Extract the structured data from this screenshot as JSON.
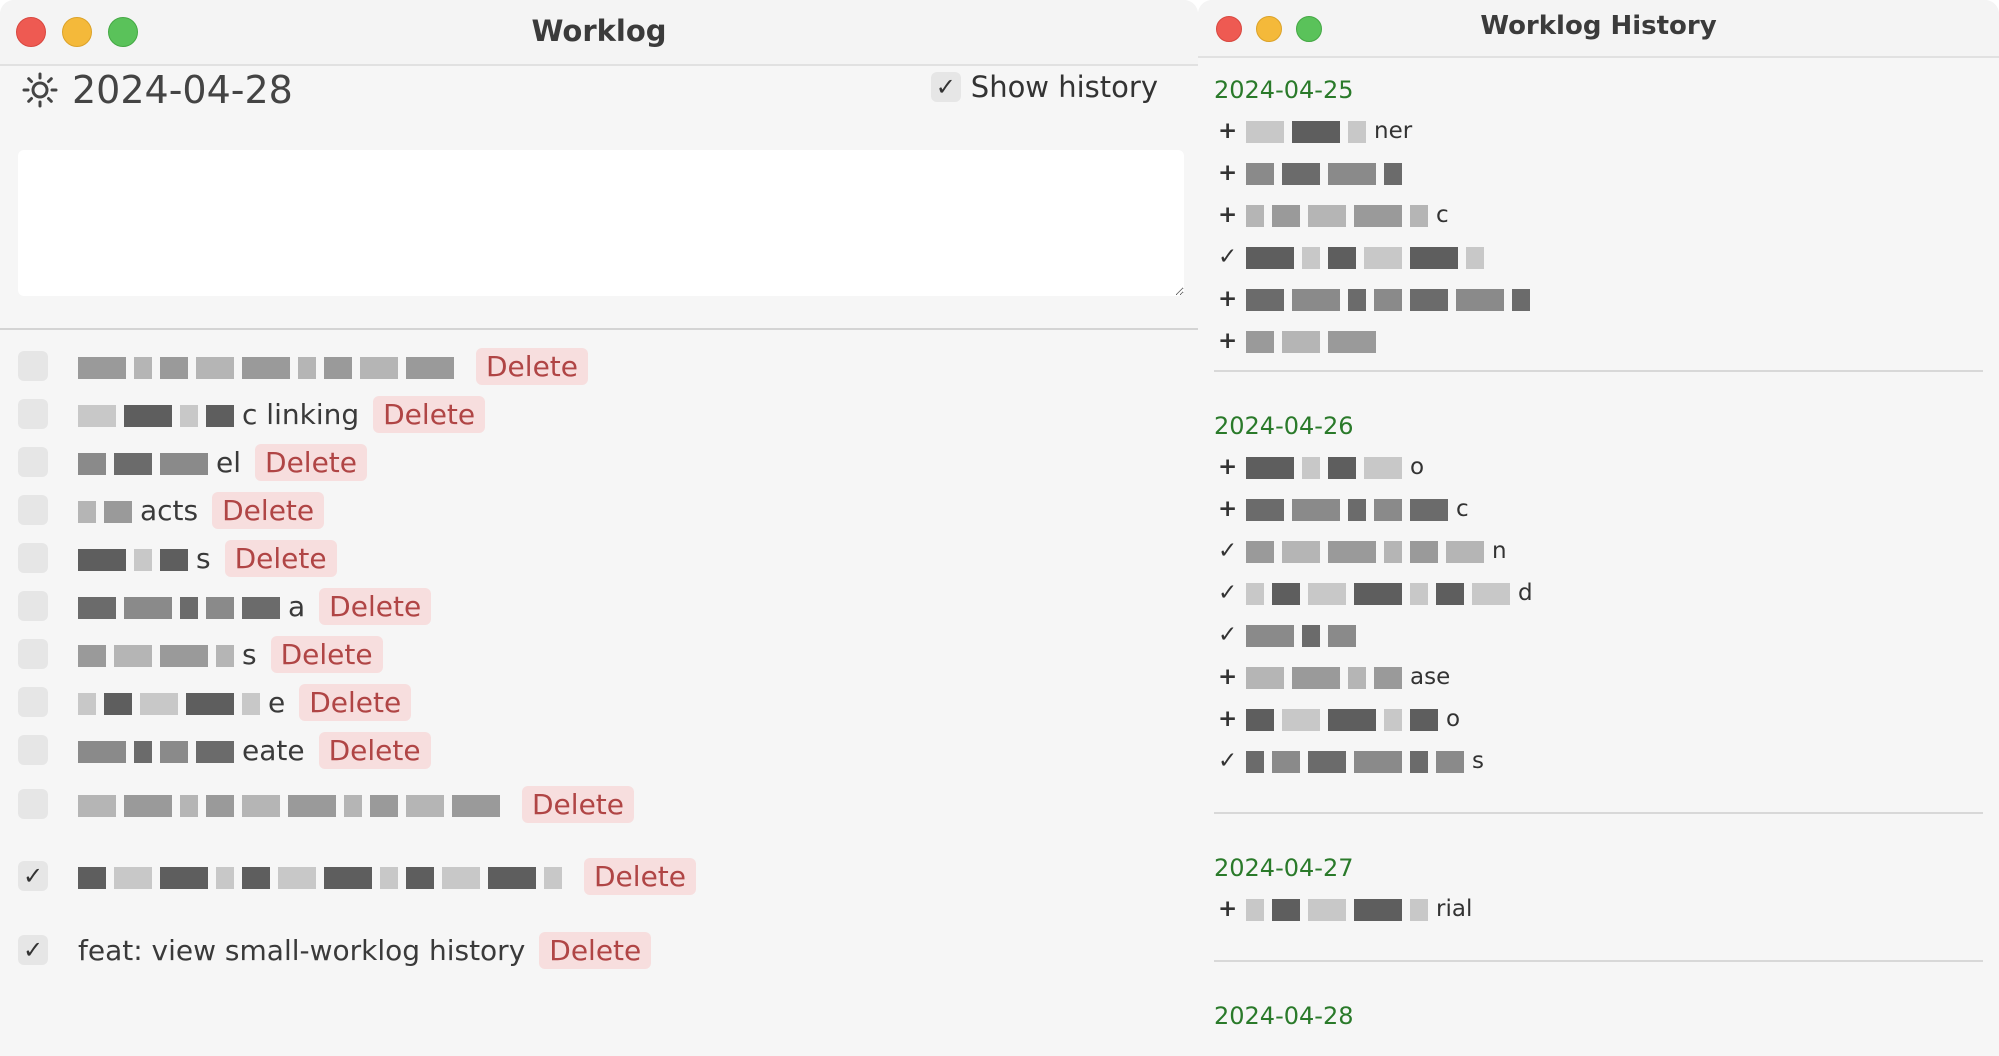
{
  "main": {
    "title": "Worklog",
    "date": "2024-04-28",
    "show_history_label": "Show history",
    "show_history_check": "✓",
    "delete_label": "Delete",
    "todos": [
      {
        "text": "",
        "check": ""
      },
      {
        "text": "c linking",
        "check": ""
      },
      {
        "text": "el",
        "check": ""
      },
      {
        "text": "acts",
        "check": ""
      },
      {
        "text": "s",
        "check": ""
      },
      {
        "text": "a",
        "check": ""
      },
      {
        "text": "s",
        "check": ""
      },
      {
        "text": "e",
        "check": ""
      },
      {
        "text": "eate",
        "check": ""
      },
      {
        "text": "",
        "check": ""
      },
      {
        "text": "",
        "check": "✓"
      },
      {
        "text": "feat: view small-worklog history",
        "check": "✓"
      }
    ]
  },
  "history": {
    "title": "Worklog History",
    "days": [
      {
        "date": "2024-04-25",
        "items": [
          {
            "mark": "+",
            "text": "ner"
          },
          {
            "mark": "+",
            "text": ""
          },
          {
            "mark": "+",
            "text": "c"
          },
          {
            "mark": "✓",
            "text": ""
          },
          {
            "mark": "+",
            "text": ""
          },
          {
            "mark": "+",
            "text": ""
          }
        ]
      },
      {
        "date": "2024-04-26",
        "items": [
          {
            "mark": "+",
            "text": "o"
          },
          {
            "mark": "+",
            "text": "c"
          },
          {
            "mark": "✓",
            "text": "n"
          },
          {
            "mark": "✓",
            "text": "d"
          },
          {
            "mark": "✓",
            "text": ""
          },
          {
            "mark": "+",
            "text": "ase"
          },
          {
            "mark": "+",
            "text": "o"
          },
          {
            "mark": "✓",
            "text": "s"
          }
        ]
      },
      {
        "date": "2024-04-27",
        "items": [
          {
            "mark": "+",
            "text": "rial"
          }
        ]
      },
      {
        "date": "2024-04-28",
        "items": []
      }
    ]
  },
  "colors": {
    "accent_green": "#2a7a2a",
    "delete_bg": "#f7dede",
    "delete_text": "#b04545"
  }
}
